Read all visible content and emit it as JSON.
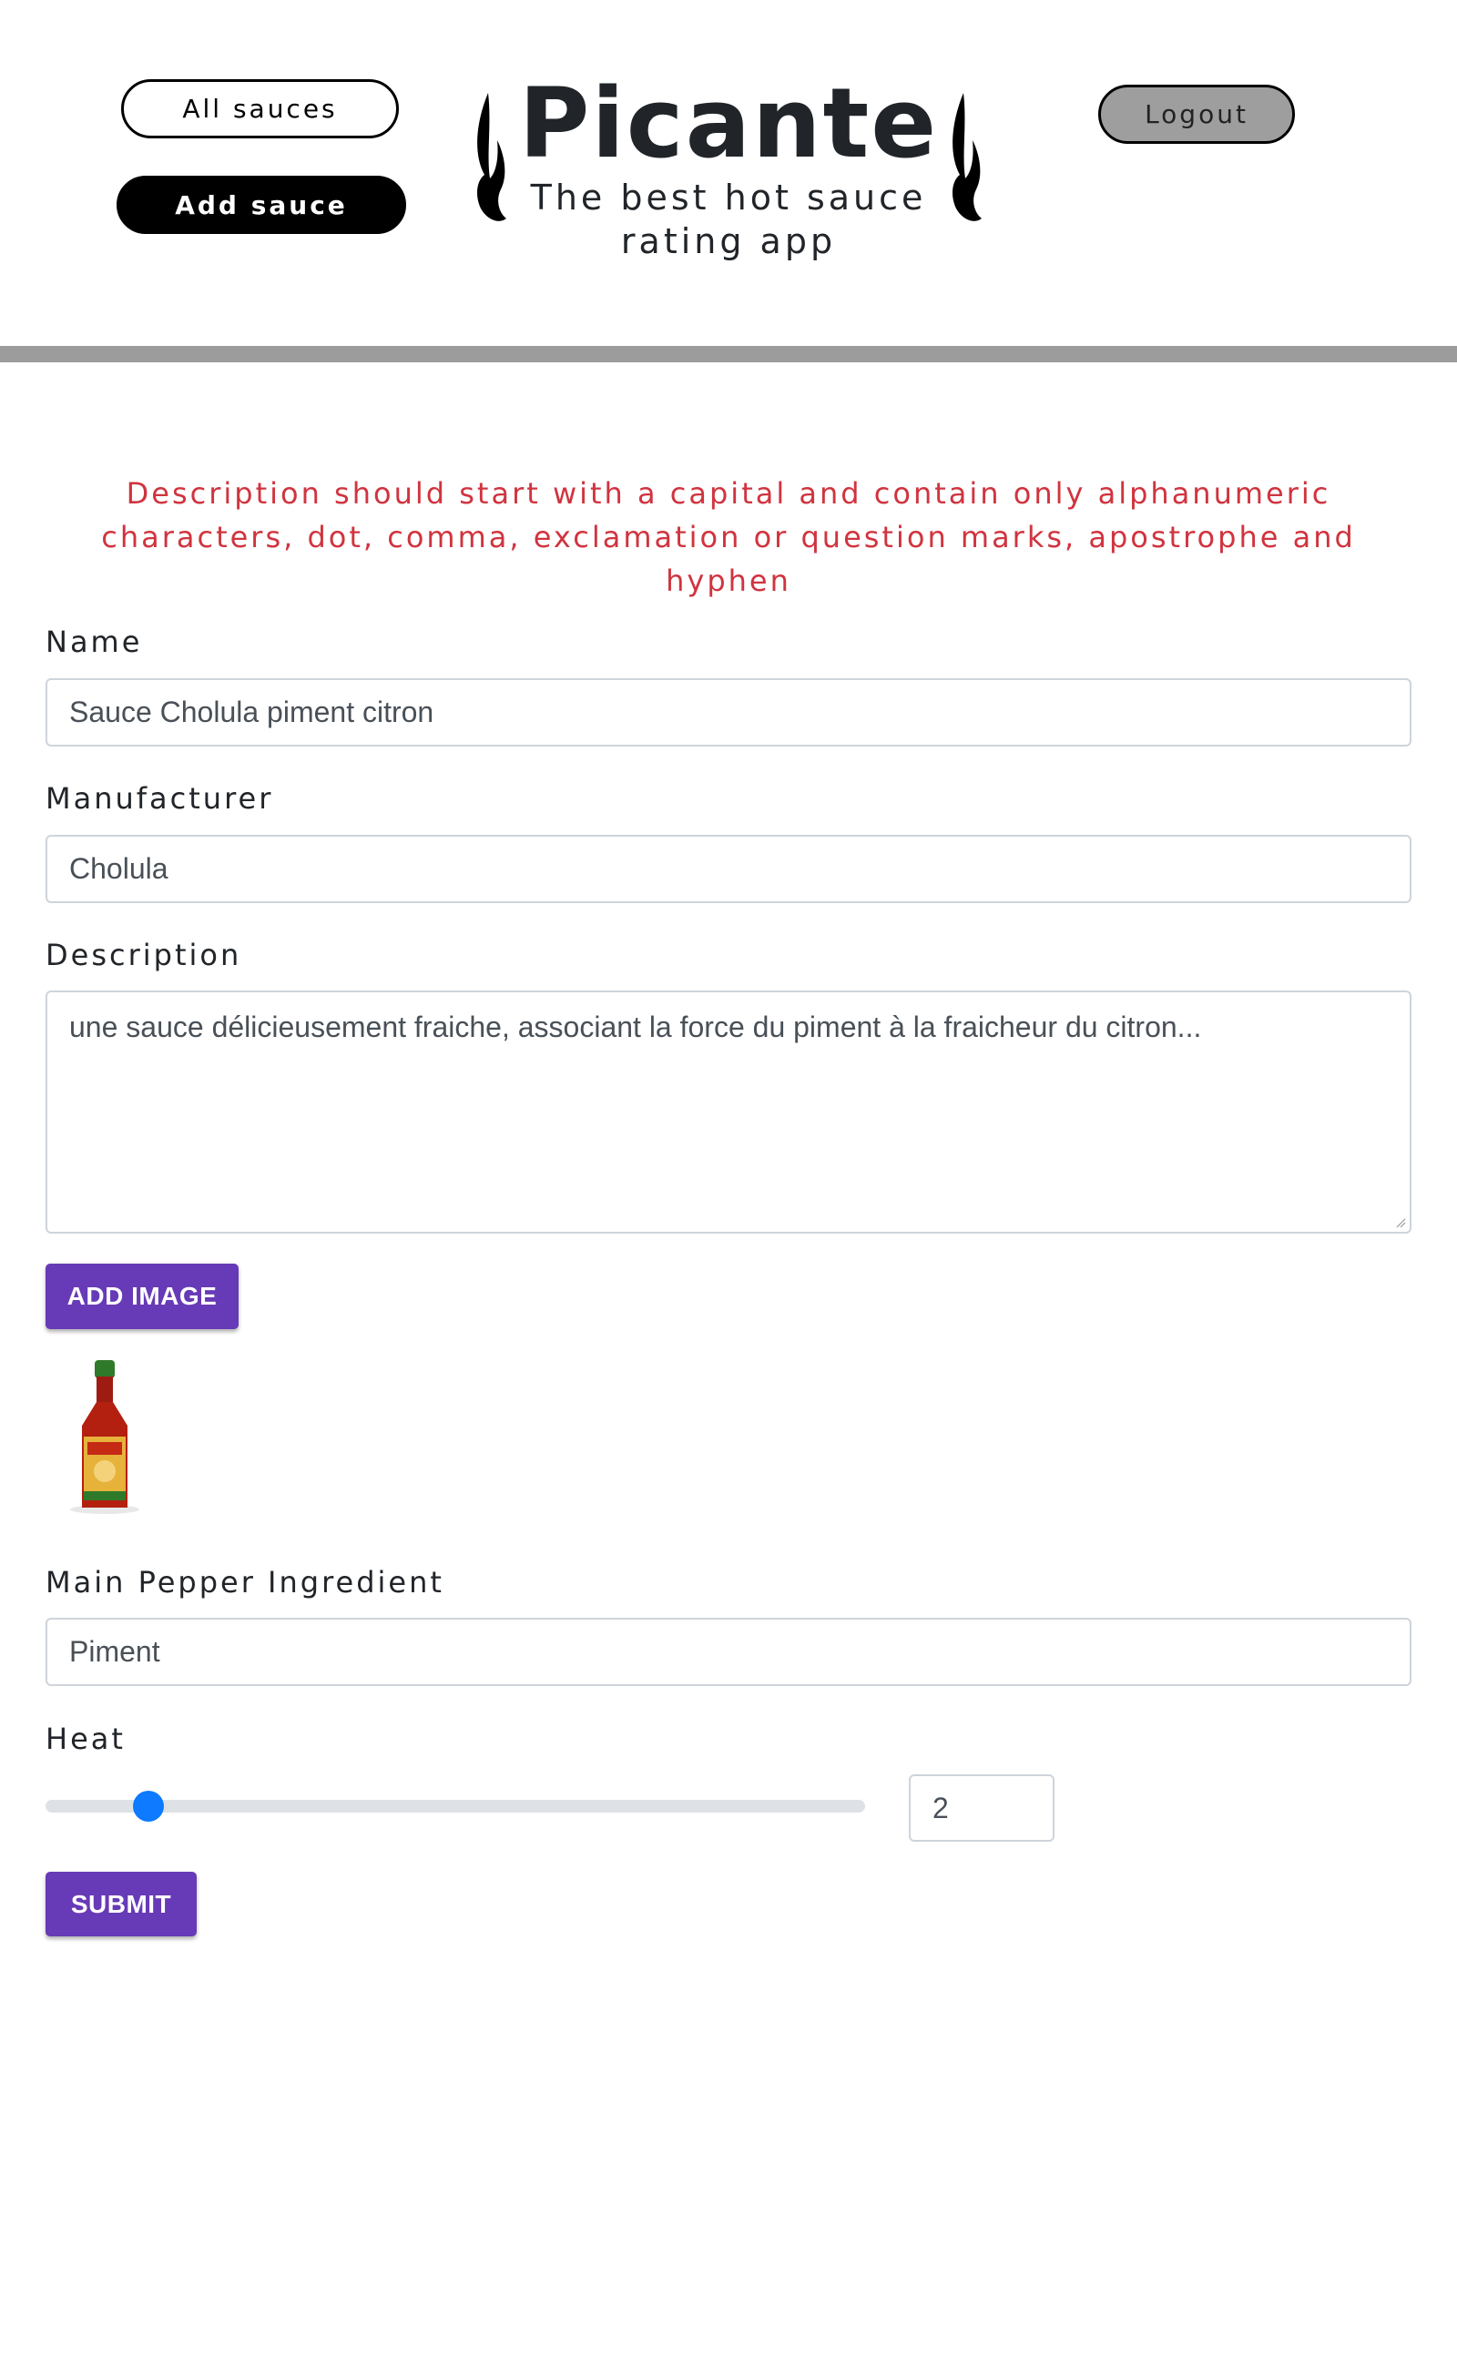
{
  "nav": {
    "all_sauces": "All sauces",
    "add_sauce": "Add sauce",
    "logout": "Logout"
  },
  "brand": {
    "title": "Picante",
    "subtitle_line1": "The best hot sauce",
    "subtitle_line2": "rating app",
    "icon": "flame-icon"
  },
  "form": {
    "error_message": "Description should start with a capital and contain only alphanumeric characters, dot, comma, exclamation or question marks, apostrophe and hyphen",
    "name": {
      "label": "Name",
      "value": "Sauce Cholula piment citron"
    },
    "manufacturer": {
      "label": "Manufacturer",
      "value": "Cholula"
    },
    "description": {
      "label": "Description",
      "value": "une sauce délicieusement fraiche, associant la force du piment à la fraicheur du citron..."
    },
    "add_image_label": "ADD IMAGE",
    "image_preview": "hot-sauce-bottle-image",
    "main_pepper": {
      "label": "Main Pepper Ingredient",
      "value": "Piment"
    },
    "heat": {
      "label": "Heat",
      "value": 2,
      "min": 1,
      "max": 10
    },
    "submit_label": "SUBMIT"
  },
  "colors": {
    "error": "#d0343f",
    "primary_button": "#673ab7",
    "slider_thumb": "#0d7aff",
    "divider": "#9c9c9c",
    "logout_bg": "#9e9e9e"
  }
}
